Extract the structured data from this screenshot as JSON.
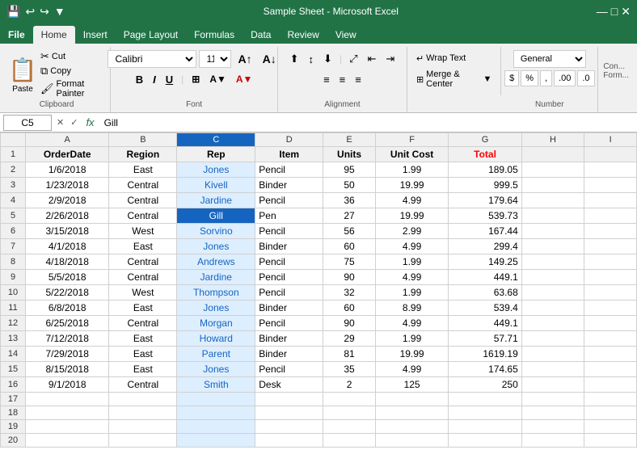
{
  "titleBar": {
    "text": "Sample Sheet  -  Microsoft Excel",
    "icons": [
      "💾",
      "↩",
      "↪",
      "▼"
    ]
  },
  "ribbonTabs": [
    {
      "label": "File",
      "isFile": true
    },
    {
      "label": "Home",
      "active": true
    },
    {
      "label": "Insert"
    },
    {
      "label": "Page Layout"
    },
    {
      "label": "Formulas"
    },
    {
      "label": "Data"
    },
    {
      "label": "Review"
    },
    {
      "label": "View"
    }
  ],
  "clipboard": {
    "paste": "Paste",
    "cut": "Cut",
    "copy": "Copy",
    "formatPainter": "Format Painter",
    "label": "Clipboard"
  },
  "font": {
    "name": "Calibri",
    "size": "11",
    "bold": "B",
    "italic": "I",
    "underline": "U",
    "label": "Font"
  },
  "alignment": {
    "wrapText": "Wrap Text",
    "mergeCenter": "Merge & Center",
    "label": "Alignment"
  },
  "number": {
    "format": "General",
    "dollar": "$",
    "percent": "%",
    "comma": ",",
    "decInc": ".00",
    "decDec": ".0",
    "label": "Number"
  },
  "formulaBar": {
    "cellRef": "C5",
    "formula": "Gill"
  },
  "columns": [
    "",
    "A",
    "B",
    "C",
    "D",
    "E",
    "F",
    "G",
    "H",
    "I"
  ],
  "headers": [
    "OrderDate",
    "Region",
    "Rep",
    "Item",
    "Units",
    "Unit Cost",
    "Total"
  ],
  "rows": [
    {
      "row": 1,
      "A": "OrderDate",
      "B": "Region",
      "C": "Rep",
      "D": "Item",
      "E": "Units",
      "F": "Unit Cost",
      "G": "Total"
    },
    {
      "row": 2,
      "A": "1/6/2018",
      "B": "East",
      "C": "Jones",
      "D": "Pencil",
      "E": "95",
      "F": "1.99",
      "G": "189.05"
    },
    {
      "row": 3,
      "A": "1/23/2018",
      "B": "Central",
      "C": "Kivell",
      "D": "Binder",
      "E": "50",
      "F": "19.99",
      "G": "999.5"
    },
    {
      "row": 4,
      "A": "2/9/2018",
      "B": "Central",
      "C": "Jardine",
      "D": "Pencil",
      "E": "36",
      "F": "4.99",
      "G": "179.64"
    },
    {
      "row": 5,
      "A": "2/26/2018",
      "B": "Central",
      "C": "Gill",
      "D": "Pen",
      "E": "27",
      "F": "19.99",
      "G": "539.73"
    },
    {
      "row": 6,
      "A": "3/15/2018",
      "B": "West",
      "C": "Sorvino",
      "D": "Pencil",
      "E": "56",
      "F": "2.99",
      "G": "167.44"
    },
    {
      "row": 7,
      "A": "4/1/2018",
      "B": "East",
      "C": "Jones",
      "D": "Binder",
      "E": "60",
      "F": "4.99",
      "G": "299.4"
    },
    {
      "row": 8,
      "A": "4/18/2018",
      "B": "Central",
      "C": "Andrews",
      "D": "Pencil",
      "E": "75",
      "F": "1.99",
      "G": "149.25"
    },
    {
      "row": 9,
      "A": "5/5/2018",
      "B": "Central",
      "C": "Jardine",
      "D": "Pencil",
      "E": "90",
      "F": "4.99",
      "G": "449.1"
    },
    {
      "row": 10,
      "A": "5/22/2018",
      "B": "West",
      "C": "Thompson",
      "D": "Pencil",
      "E": "32",
      "F": "1.99",
      "G": "63.68"
    },
    {
      "row": 11,
      "A": "6/8/2018",
      "B": "East",
      "C": "Jones",
      "D": "Binder",
      "E": "60",
      "F": "8.99",
      "G": "539.4"
    },
    {
      "row": 12,
      "A": "6/25/2018",
      "B": "Central",
      "C": "Morgan",
      "D": "Pencil",
      "E": "90",
      "F": "4.99",
      "G": "449.1"
    },
    {
      "row": 13,
      "A": "7/12/2018",
      "B": "East",
      "C": "Howard",
      "D": "Binder",
      "E": "29",
      "F": "1.99",
      "G": "57.71"
    },
    {
      "row": 14,
      "A": "7/29/2018",
      "B": "East",
      "C": "Parent",
      "D": "Binder",
      "E": "81",
      "F": "19.99",
      "G": "1619.19"
    },
    {
      "row": 15,
      "A": "8/15/2018",
      "B": "East",
      "C": "Jones",
      "D": "Pencil",
      "E": "35",
      "F": "4.99",
      "G": "174.65"
    },
    {
      "row": 16,
      "A": "9/1/2018",
      "B": "Central",
      "C": "Smith",
      "D": "Desk",
      "E": "2",
      "F": "125",
      "G": "250"
    },
    {
      "row": 17,
      "A": "",
      "B": "",
      "C": "",
      "D": "",
      "E": "",
      "F": "",
      "G": ""
    },
    {
      "row": 18,
      "A": "",
      "B": "",
      "C": "",
      "D": "",
      "E": "",
      "F": "",
      "G": ""
    },
    {
      "row": 19,
      "A": "",
      "B": "",
      "C": "",
      "D": "",
      "E": "",
      "F": "",
      "G": ""
    },
    {
      "row": 20,
      "A": "",
      "B": "",
      "C": "",
      "D": "",
      "E": "",
      "F": "",
      "G": ""
    }
  ],
  "activeCell": {
    "row": 5,
    "col": "C"
  }
}
